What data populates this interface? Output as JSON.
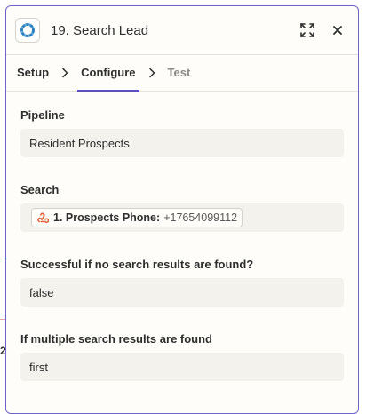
{
  "header": {
    "title": "19. Search Lead"
  },
  "tabs": [
    {
      "label": "Setup"
    },
    {
      "label": "Configure"
    },
    {
      "label": "Test"
    }
  ],
  "fields": {
    "pipeline": {
      "label": "Pipeline",
      "value": "Resident Prospects"
    },
    "search": {
      "label": "Search",
      "token_key": "1. Prospects Phone:",
      "token_value": "+17654099112"
    },
    "no_results": {
      "label": "Successful if no search results are found?",
      "value": "false"
    },
    "multiple": {
      "label": "If multiple search results are found",
      "value": "first"
    }
  },
  "background": {
    "fragment": "2"
  },
  "colors": {
    "accent": "#5b4fc4",
    "panel_border": "#6d63c9",
    "field_bg": "#f4f2ec",
    "token_icon": "#e0603a"
  },
  "icons": {
    "app": "ring-logo-icon",
    "expand": "expand-icon",
    "close": "close-icon",
    "token": "webhook-icon",
    "separator": "chevron-right-icon"
  }
}
